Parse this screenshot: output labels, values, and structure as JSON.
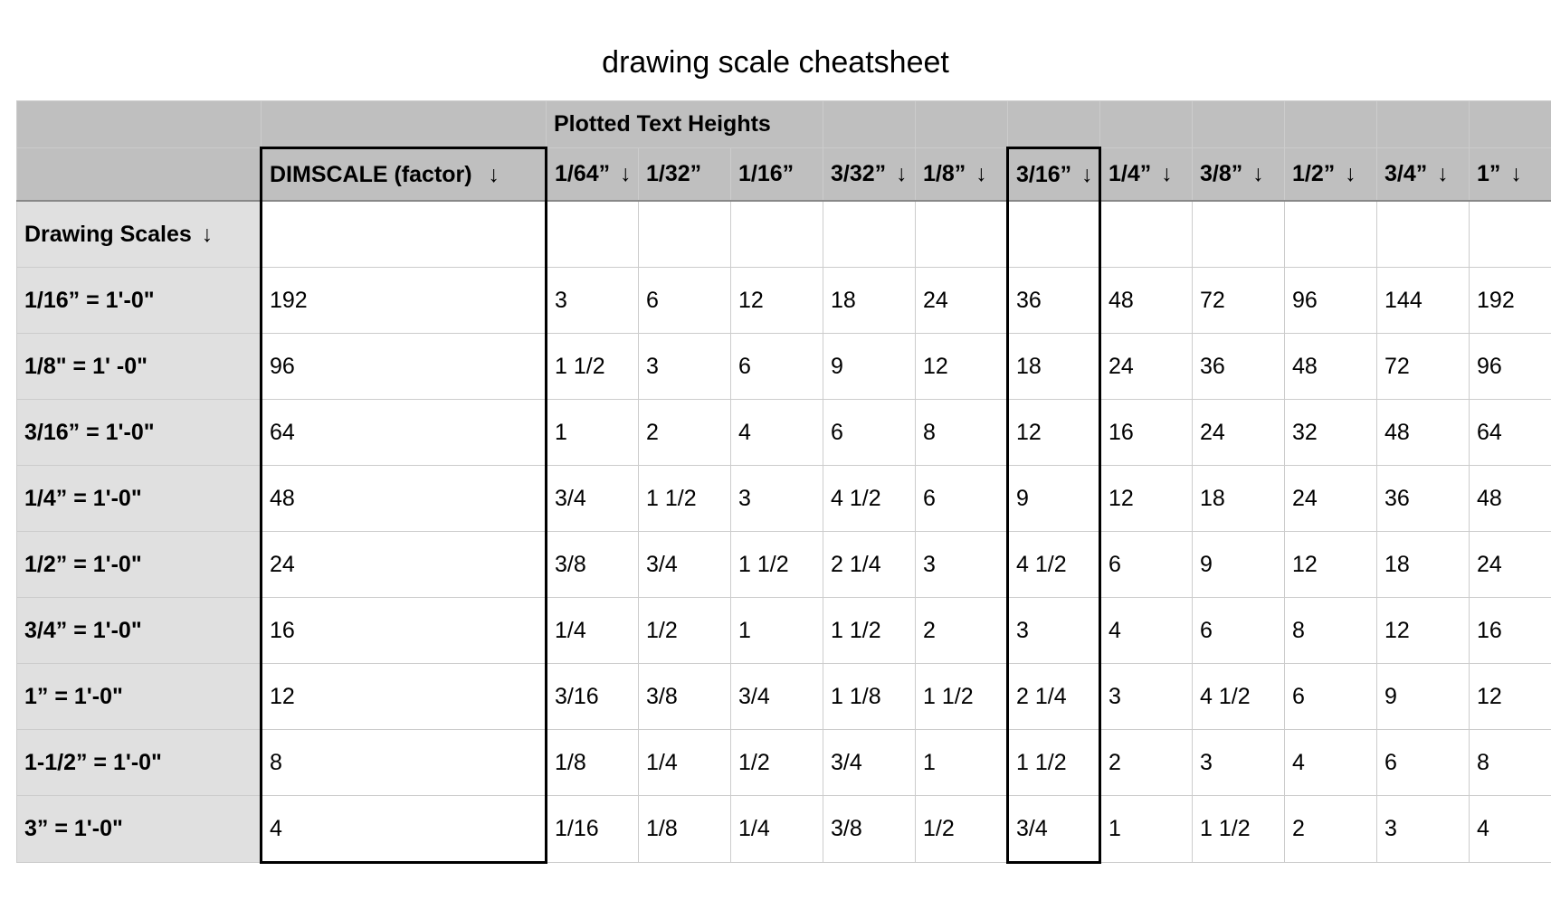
{
  "title": "drawing scale cheatsheet",
  "arrow": "↓",
  "header": {
    "group_label": "Plotted Text Heights",
    "dimscale_label": "DIMSCALE (factor)",
    "row_axis_label": "Drawing Scales",
    "columns": [
      "1/64”",
      "1/32”",
      "1/16”",
      "3/32”",
      "1/8”",
      "3/16”",
      "1/4”",
      "3/8”",
      "1/2”",
      "3/4”",
      "1”"
    ]
  },
  "rows": [
    {
      "label": "1/16” = 1'-0\"",
      "dimscale": "192",
      "values": [
        "3",
        "6",
        "12",
        "18",
        "24",
        "36",
        "48",
        "72",
        "96",
        "144",
        "192"
      ]
    },
    {
      "label": "1/8\" = 1' -0\"",
      "dimscale": "96",
      "values": [
        "1 1/2",
        "3",
        "6",
        "9",
        "12",
        "18",
        "24",
        "36",
        "48",
        "72",
        "96"
      ]
    },
    {
      "label": "3/16” = 1'-0\"",
      "dimscale": "64",
      "values": [
        "1",
        "2",
        "4",
        "6",
        "8",
        "12",
        "16",
        "24",
        "32",
        "48",
        "64"
      ]
    },
    {
      "label": "1/4” = 1'-0\"",
      "dimscale": "48",
      "values": [
        "3/4",
        "1 1/2",
        "3",
        "4 1/2",
        "6",
        "9",
        "12",
        "18",
        "24",
        "36",
        "48"
      ]
    },
    {
      "label": "1/2” = 1'-0\"",
      "dimscale": "24",
      "values": [
        "3/8",
        "3/4",
        "1 1/2",
        "2 1/4",
        "3",
        "4 1/2",
        "6",
        "9",
        "12",
        "18",
        "24"
      ]
    },
    {
      "label": "3/4” = 1'-0\"",
      "dimscale": "16",
      "values": [
        "1/4",
        "1/2",
        "1",
        "1 1/2",
        "2",
        "3",
        "4",
        "6",
        "8",
        "12",
        "16"
      ]
    },
    {
      "label": "1” = 1'-0\"",
      "dimscale": "12",
      "values": [
        "3/16",
        "3/8",
        "3/4",
        "1 1/8",
        "1 1/2",
        "2 1/4",
        "3",
        "4 1/2",
        "6",
        "9",
        "12"
      ]
    },
    {
      "label": "1-1/2” = 1'-0\"",
      "dimscale": "8",
      "values": [
        "1/8",
        "1/4",
        "1/2",
        "3/4",
        "1",
        "1 1/2",
        "2",
        "3",
        "4",
        "6",
        "8"
      ]
    },
    {
      "label": "3” = 1'-0\"",
      "dimscale": "4",
      "values": [
        "1/16",
        "1/8",
        "1/4",
        "3/8",
        "1/2",
        "3/4",
        "1",
        "1 1/2",
        "2",
        "3",
        "4"
      ]
    }
  ]
}
